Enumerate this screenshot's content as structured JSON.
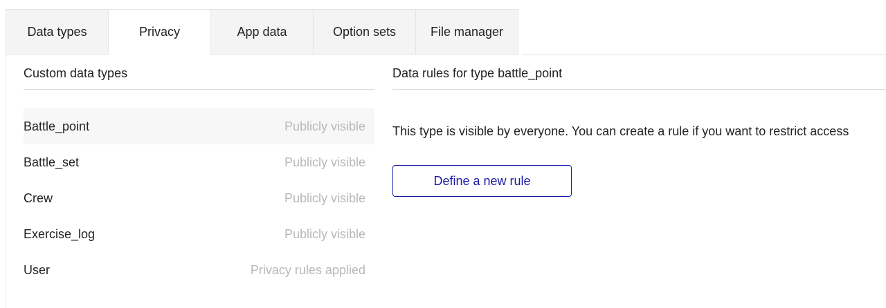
{
  "tabs": [
    {
      "label": "Data types",
      "active": false
    },
    {
      "label": "Privacy",
      "active": true
    },
    {
      "label": "App data",
      "active": false
    },
    {
      "label": "Option sets",
      "active": false
    },
    {
      "label": "File manager",
      "active": false
    }
  ],
  "left": {
    "title": "Custom data types",
    "types": [
      {
        "name": "Battle_point",
        "status": "Publicly visible",
        "selected": true
      },
      {
        "name": "Battle_set",
        "status": "Publicly visible",
        "selected": false
      },
      {
        "name": "Crew",
        "status": "Publicly visible",
        "selected": false
      },
      {
        "name": "Exercise_log",
        "status": "Publicly visible",
        "selected": false
      },
      {
        "name": "User",
        "status": "Privacy rules applied",
        "selected": false
      }
    ]
  },
  "right": {
    "title": "Data rules for type battle_point",
    "info": "This type is visible by everyone. You can create a rule if you want to restrict access",
    "define_button": "Define a new rule"
  },
  "colors": {
    "accent": "#1a1aa6",
    "muted_text": "#b8b8b8",
    "tab_bg": "#f4f4f4",
    "selected_row_bg": "#f7f7f7"
  }
}
